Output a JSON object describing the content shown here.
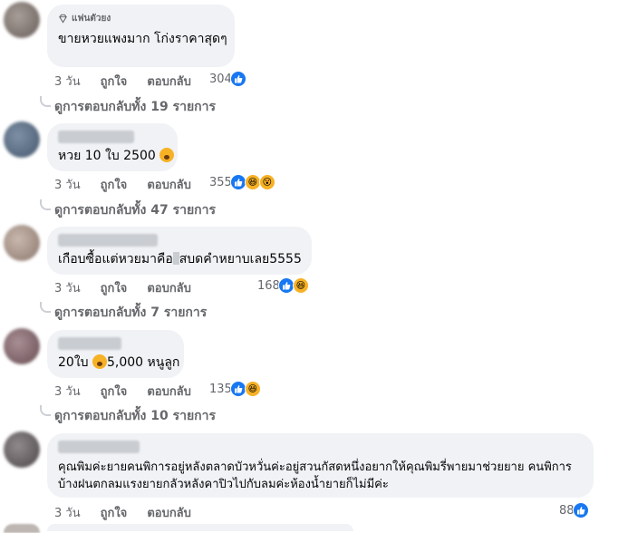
{
  "badge": "แฟนตัวยง",
  "comments": [
    {
      "text": "ขายหวยแพงมาก โก่งราคาสุดๆ",
      "time": "3 วัน",
      "like": "ถูกใจ",
      "reply": "ตอบกลับ",
      "count": "304",
      "replies": "ดูการตอบกลับทั้ง 19 รายการ"
    },
    {
      "text_before": "หวย 10 ใบ 2500",
      "time": "3 วัน",
      "like": "ถูกใจ",
      "reply": "ตอบกลับ",
      "count": "355",
      "replies": "ดูการตอบกลับทั้ง 47 รายการ"
    },
    {
      "text_before": "เกือบซื้อแต่หวยมาคือ",
      "text_after": "สบดคำหยาบเลย5555",
      "time": "3 วัน",
      "like": "ถูกใจ",
      "reply": "ตอบกลับ",
      "count": "168",
      "replies": "ดูการตอบกลับทั้ง 7 รายการ"
    },
    {
      "text_before": "20ใบ",
      "text_after": "5,000 หนูลูก",
      "time": "3 วัน",
      "like": "ถูกใจ",
      "reply": "ตอบกลับ",
      "count": "135",
      "replies": "ดูการตอบกลับทั้ง 10 รายการ"
    },
    {
      "text": "คุณพิมค่ะยายคนพิการอยู่หลังตลาดบัวหวั่นค่ะอยู่สวนกัสดหนึ่งอยากให้คุณพิมรี่พายมาช่วยยาย คนพิการบ้างฝนตกลมแรงยายกลัวหลังคาปิวไปกับลมค่ะห้องน้ำยายก็ไม่มีค่ะ",
      "time": "3 วัน",
      "like": "ถูกใจ",
      "reply": "ตอบกลับ",
      "count": "88"
    }
  ],
  "colors": {
    "bubble": "#f0f2f5",
    "meta": "#65676b",
    "like": "#1877f2",
    "emoji": "#f7b125"
  },
  "icons": {
    "badge": "diamond-icon",
    "like": "thumbs-up-icon",
    "haha": "haha-face-icon",
    "wow": "wow-face-icon"
  }
}
